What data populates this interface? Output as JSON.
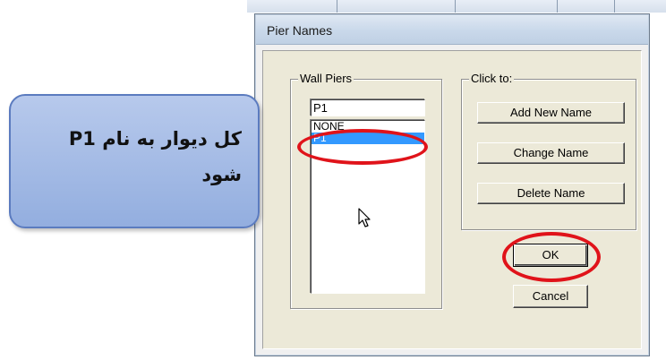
{
  "dialog": {
    "title": "Pier Names",
    "wall_piers_group": {
      "label": "Wall Piers",
      "name_input_value": "P1",
      "list_items": [
        "NONE",
        "P1"
      ],
      "selected_item": "P1"
    },
    "click_to_group": {
      "label": "Click to:",
      "add_label": "Add New Name",
      "change_label": "Change Name",
      "delete_label": "Delete Name"
    },
    "ok_label": "OK",
    "cancel_label": "Cancel"
  },
  "annotation": {
    "text": "کل دیوار به نام P1 شود",
    "highlight_color": "#e0131a",
    "callout_color": "#a6bce6"
  },
  "icons": [
    "mouse-pointer-icon"
  ],
  "colors": {
    "selection": "#3399ff",
    "dialog_face": "#ece9d8"
  }
}
